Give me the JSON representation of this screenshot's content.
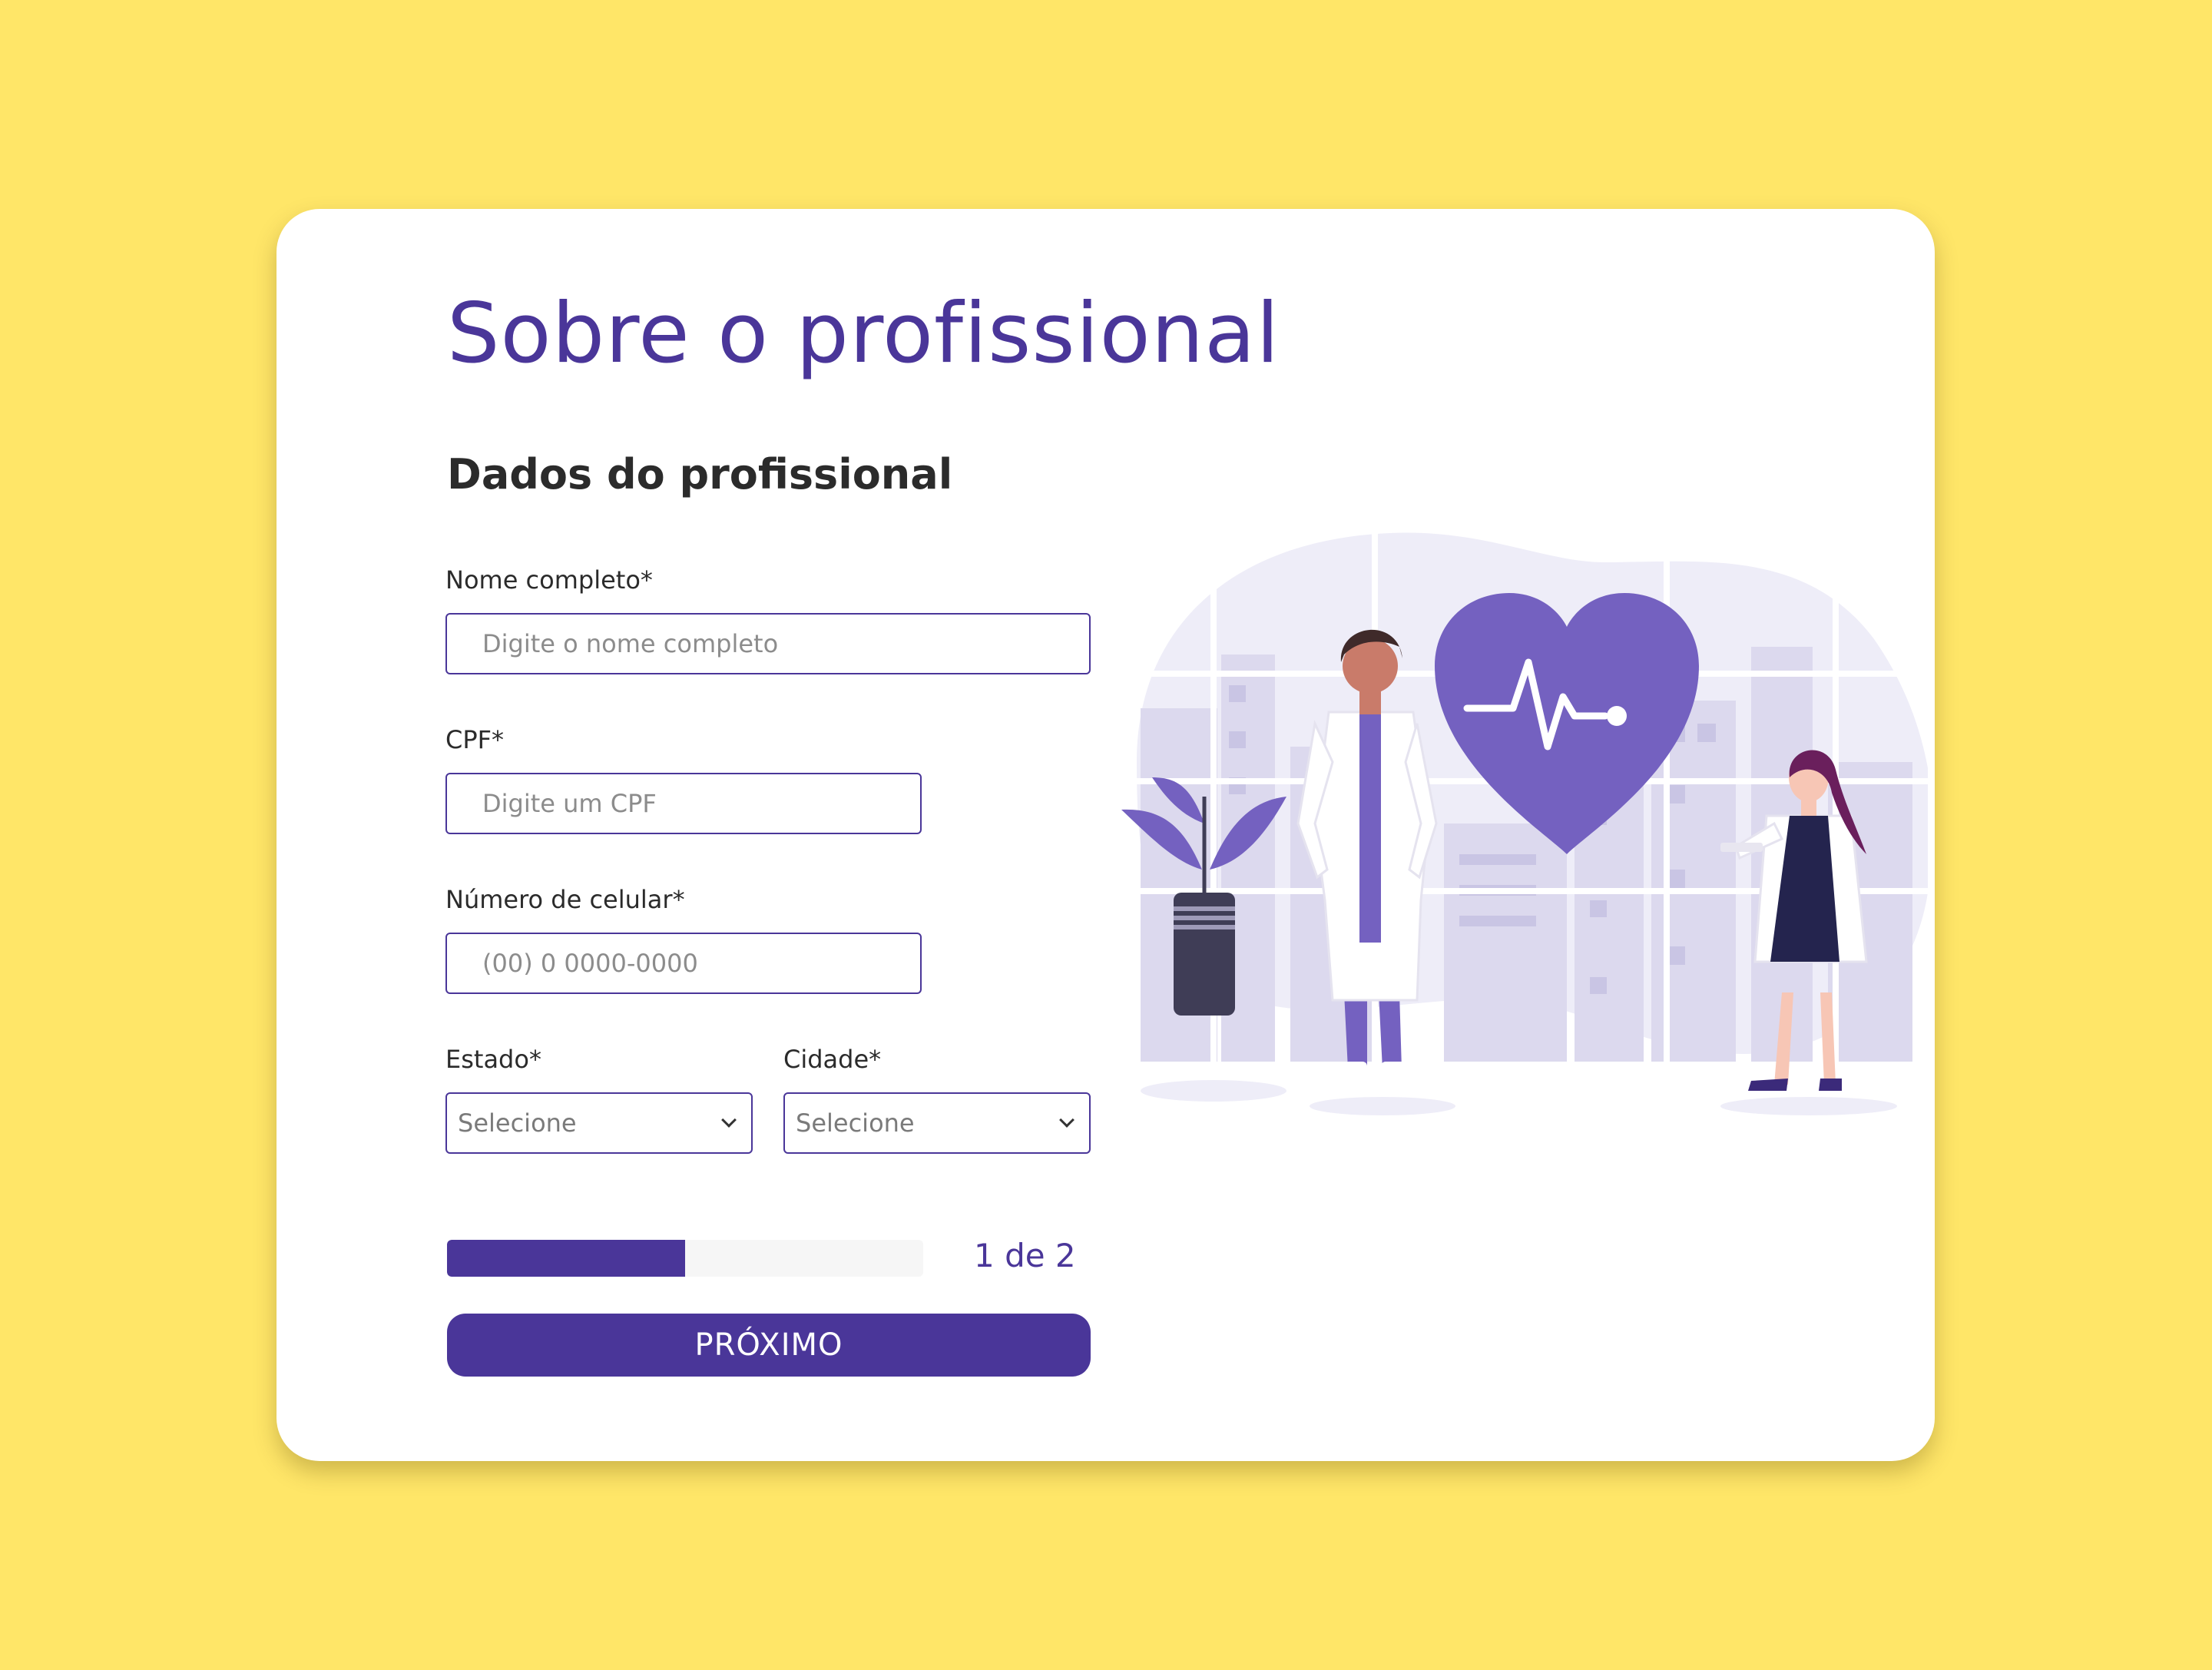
{
  "page": {
    "title": "Sobre o profissional",
    "subtitle": "Dados do profissional"
  },
  "form": {
    "name": {
      "label": "Nome completo*",
      "placeholder": "Digite o nome completo",
      "value": ""
    },
    "cpf": {
      "label": "CPF*",
      "placeholder": "Digite um CPF",
      "value": ""
    },
    "phone": {
      "label": "Número de celular*",
      "placeholder": "(00) 0 0000-0000",
      "value": ""
    },
    "state": {
      "label": "Estado*",
      "selected": "Selecione"
    },
    "city": {
      "label": "Cidade*",
      "selected": "Selecione"
    }
  },
  "progress": {
    "text": "1 de 2",
    "current_step": 1,
    "total_steps": 2,
    "fraction": 0.5
  },
  "actions": {
    "next_label": "PRÓXIMO"
  },
  "colors": {
    "background": "#FFE668",
    "accent": "#4A3699",
    "illustration_purple": "#7461C0",
    "illustration_light": "#EEEDF8"
  },
  "illustration": {
    "icons": [
      "heart-icon",
      "heartbeat-icon",
      "plant-icon",
      "doctor-male-figure",
      "doctor-female-figure"
    ]
  }
}
